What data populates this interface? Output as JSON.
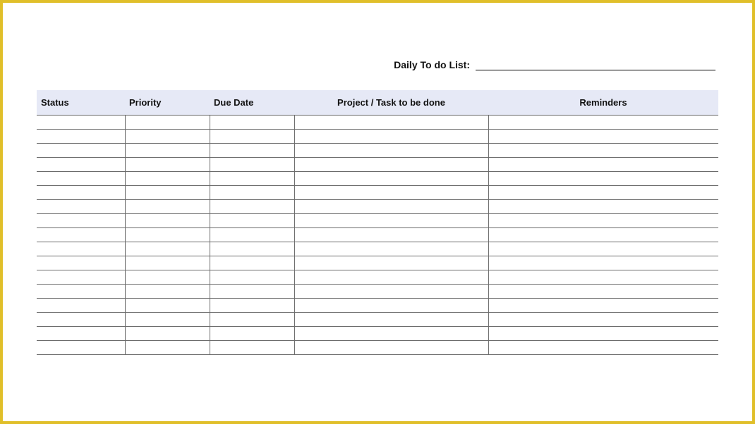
{
  "title_label": "Daily To do List:",
  "columns": {
    "status": "Status",
    "priority": "Priority",
    "due_date": "Due Date",
    "project": "Project / Task to be done",
    "reminders": "Reminders"
  },
  "row_count": 17
}
